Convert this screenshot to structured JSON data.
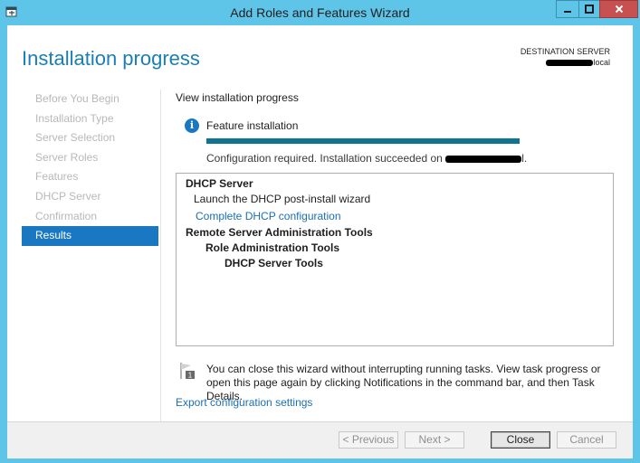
{
  "window": {
    "title": "Add Roles and Features Wizard",
    "accent_color": "#5fc5e8",
    "close_color": "#c75050"
  },
  "header": {
    "title": "Installation progress",
    "destination_label": "DESTINATION SERVER",
    "destination_value_suffix": "local"
  },
  "nav": {
    "items": [
      {
        "label": "Before You Begin",
        "state": "disabled"
      },
      {
        "label": "Installation Type",
        "state": "disabled"
      },
      {
        "label": "Server Selection",
        "state": "disabled"
      },
      {
        "label": "Server Roles",
        "state": "disabled"
      },
      {
        "label": "Features",
        "state": "disabled"
      },
      {
        "label": "DHCP Server",
        "state": "disabled"
      },
      {
        "label": "Confirmation",
        "state": "disabled"
      },
      {
        "label": "Results",
        "state": "active"
      }
    ],
    "active_color": "#1a78c2"
  },
  "main": {
    "view_label": "View installation progress",
    "feature_label": "Feature installation",
    "progress_percent": 100,
    "progress_color": "#0e7490",
    "status_prefix": "Configuration required. Installation succeeded on",
    "status_suffix": "l.",
    "results": {
      "dhcp_server": "DHCP Server",
      "launch_wizard": "Launch the DHCP post-install wizard",
      "complete_link": "Complete DHCP configuration",
      "rsat": "Remote Server Administration Tools",
      "role_admin": "Role Administration Tools",
      "dhcp_tools": "DHCP Server Tools"
    },
    "note": "You can close this wizard without interrupting running tasks. View task progress or open this page again by clicking Notifications in the command bar, and then Task Details.",
    "notification_count": "1",
    "export_link": "Export configuration settings"
  },
  "footer": {
    "previous": "< Previous",
    "next": "Next >",
    "close": "Close",
    "cancel": "Cancel"
  }
}
